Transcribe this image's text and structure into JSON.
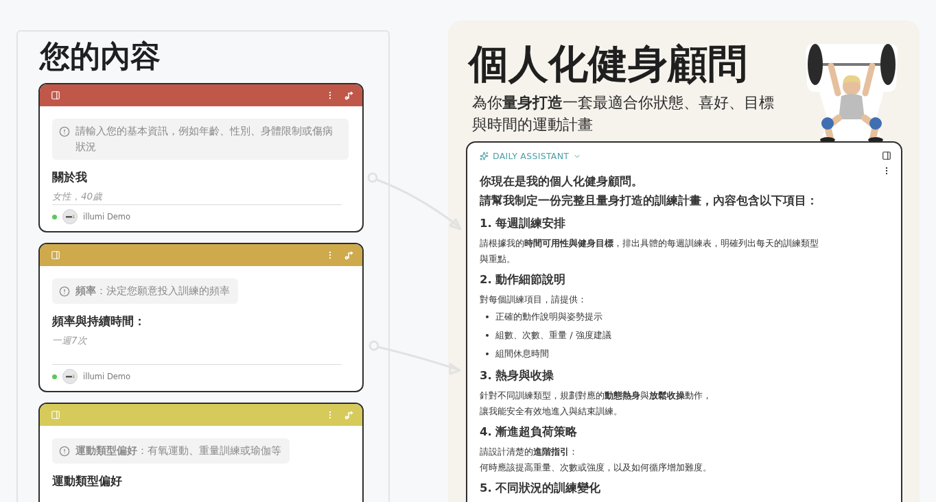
{
  "content_panel": {
    "title": "您的內容",
    "cards": [
      {
        "color": "#c0584a",
        "hint": "請輸入您的基本資訊，例如年齡、性別、身體限制或傷病狀況",
        "title": "關於我",
        "value": "女性，40歲",
        "author": "illumi Demo",
        "online": true
      },
      {
        "color": "#cfaa4c",
        "hint": "**頻率**：決定您願意投入訓練的頻率",
        "title": "頻率與持續時間：",
        "value": "一週7次",
        "author": "illumi Demo",
        "online": true
      },
      {
        "color": "#d6cb5a",
        "hint": "**運動類型偏好**：有氧運動、重量訓練或瑜伽等",
        "title": "運動類型偏好"
      }
    ]
  },
  "advisor_panel": {
    "title": "個人化健身顧問",
    "subtitle": "為你**量身打造**一套最適合你狀態、喜好、目標與時間的運動計畫",
    "assistant": {
      "label": "DAILY ASSISTANT",
      "blocks": [
        {
          "kind": "lead",
          "text": "你現在是我的個人化健身顧問。"
        },
        {
          "kind": "lead",
          "text": "請幫我制定一份完整且量身打造的訓練計畫，內容包含以下項目："
        },
        {
          "kind": "heading",
          "text": "1. 每週訓練安排"
        },
        {
          "kind": "paragraph",
          "lines": [
            "請根據我的**時間可用性與健身目標**，排出具體的每週訓練表，明確列出每天的訓練類型",
            "與重點。"
          ]
        },
        {
          "kind": "heading",
          "text": "2. 動作細節說明"
        },
        {
          "kind": "paragraph",
          "lines": [
            "對每個訓練項目，請提供："
          ]
        },
        {
          "kind": "bullet",
          "text": "正確的動作說明與姿勢提示"
        },
        {
          "kind": "bullet",
          "text": "組數、次數、重量 / 強度建議"
        },
        {
          "kind": "bullet",
          "text": "組間休息時間"
        },
        {
          "kind": "heading",
          "text": "3. 熱身與收操"
        },
        {
          "kind": "paragraph",
          "lines": [
            "針對不同訓練類型，規劃對應的**動態熱身**與**放鬆收操**動作，",
            "讓我能安全有效地進入與結束訓練。"
          ]
        },
        {
          "kind": "heading",
          "text": "4. 漸進超負荷策略"
        },
        {
          "kind": "paragraph",
          "lines": [
            "請設計清楚的**進階指引**：",
            "何時應該提高重量、次數或強度，以及如何循序增加難度。"
          ]
        },
        {
          "kind": "heading",
          "text": "5. 不同狀況的訓練變化"
        }
      ]
    }
  }
}
